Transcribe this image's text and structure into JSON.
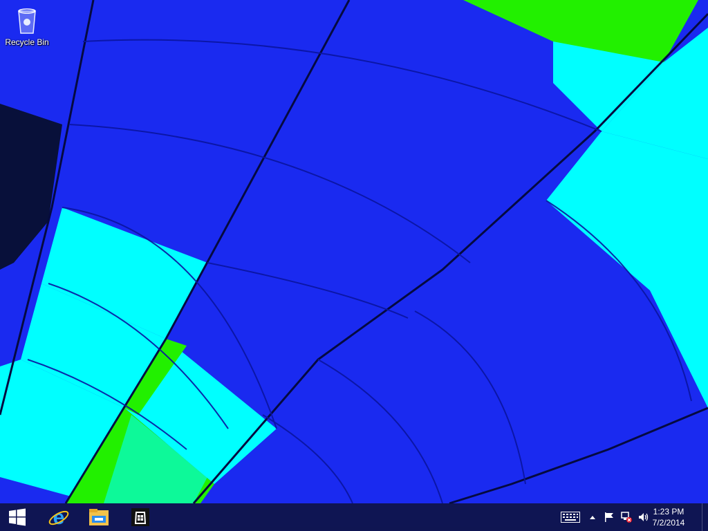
{
  "desktop": {
    "icons": [
      {
        "label": "Recycle Bin",
        "icon": "recycle-bin-icon"
      }
    ]
  },
  "taskbar": {
    "start_icon": "windows-start-icon",
    "pinned": [
      {
        "icon": "internet-explorer-icon"
      },
      {
        "icon": "file-explorer-icon"
      },
      {
        "icon": "store-icon"
      }
    ],
    "tray": {
      "icons": [
        "touch-keyboard-icon",
        "show-hidden-icons-chevron",
        "action-center-flag-icon",
        "network-icon",
        "volume-icon"
      ],
      "time": "1:23 PM",
      "date": "7/2/2014"
    }
  },
  "colors": {
    "wallpaper_blue": "#1a2af0",
    "wallpaper_cyan": "#00ffff",
    "wallpaper_green": "#22f000",
    "taskbar": "#0e123c"
  }
}
